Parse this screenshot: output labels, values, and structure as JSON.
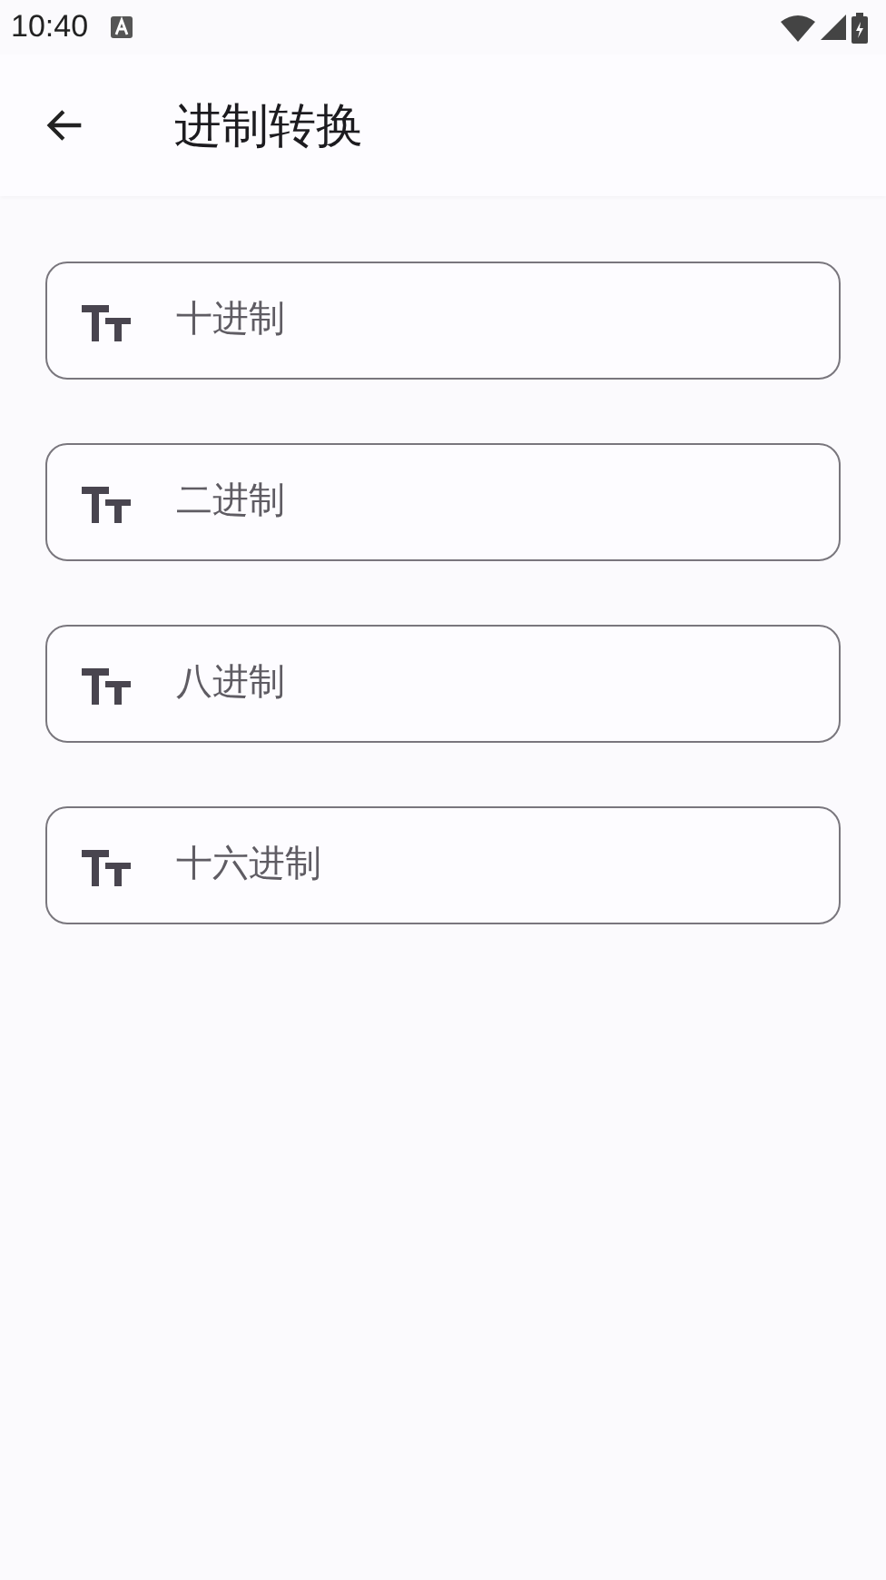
{
  "status_bar": {
    "time": "10:40"
  },
  "app_bar": {
    "title": "进制转换"
  },
  "fields": [
    {
      "placeholder": "十进制"
    },
    {
      "placeholder": "二进制"
    },
    {
      "placeholder": "八进制"
    },
    {
      "placeholder": "十六进制"
    }
  ]
}
